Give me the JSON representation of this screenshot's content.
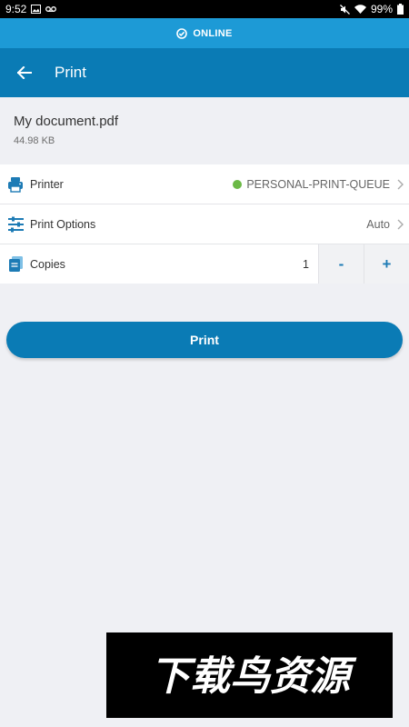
{
  "status_bar": {
    "time": "9:52",
    "battery": "99%"
  },
  "connection": {
    "label": "ONLINE"
  },
  "app_bar": {
    "title": "Print"
  },
  "document": {
    "name": "My document.pdf",
    "size": "44.98 KB"
  },
  "settings": {
    "printer": {
      "label": "Printer",
      "value": "PERSONAL-PRINT-QUEUE",
      "status_color": "#6bb946"
    },
    "print_options": {
      "label": "Print Options",
      "value": "Auto"
    },
    "copies": {
      "label": "Copies",
      "value": "1",
      "minus_label": "-",
      "plus_label": "+"
    }
  },
  "print_button": {
    "label": "Print"
  },
  "watermark": {
    "text": "下载鸟资源"
  },
  "colors": {
    "accent": "#0a7bb5",
    "online_bar": "#1d9ad6",
    "icon_blue": "#1d7bb5"
  }
}
